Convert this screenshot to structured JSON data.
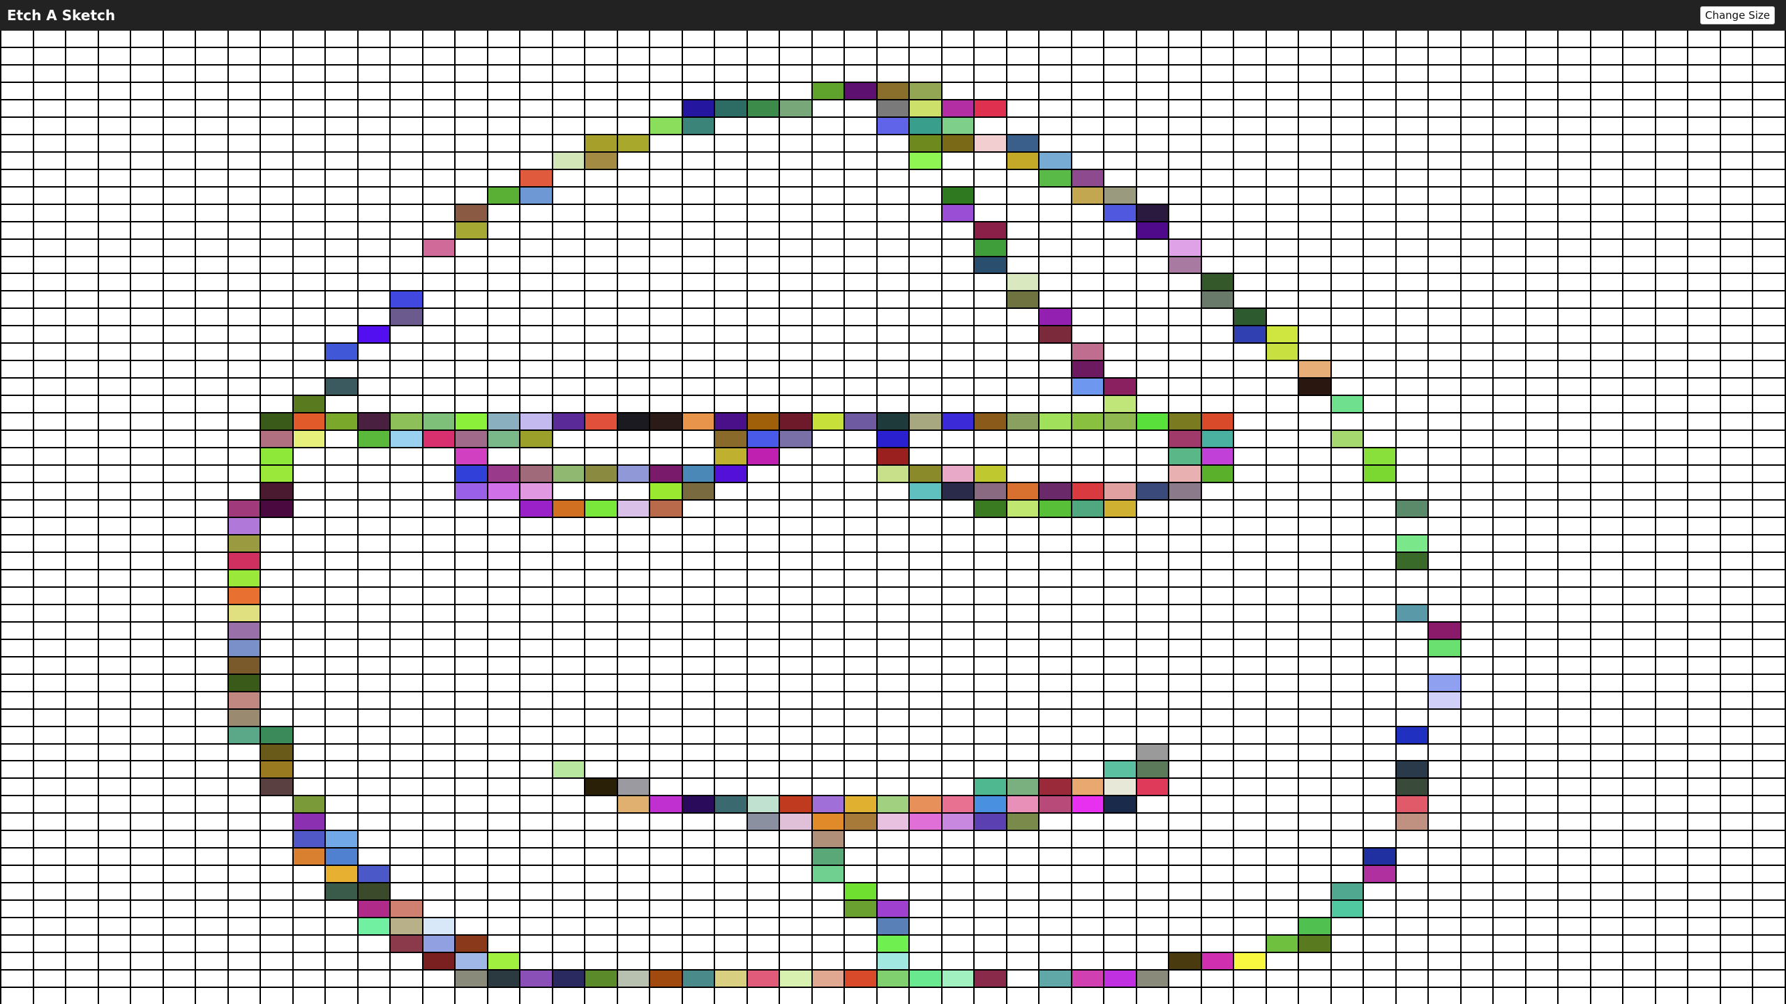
{
  "header": {
    "title": "Etch A Sketch",
    "change_size_label": "Change Size",
    "background": "#222222"
  },
  "grid": {
    "columns": 55,
    "rows": 56,
    "blank_color": "#ffffff",
    "painted": [
      [
        3,
        25,
        "#5fa32d"
      ],
      [
        3,
        26,
        "#5e1070"
      ],
      [
        3,
        27,
        "#8a6e2c"
      ],
      [
        3,
        28,
        "#93a653"
      ],
      [
        4,
        21,
        "#24169e"
      ],
      [
        4,
        22,
        "#2d6b65"
      ],
      [
        4,
        23,
        "#3d8b4a"
      ],
      [
        4,
        24,
        "#78a87a"
      ],
      [
        4,
        27,
        "#7a7a7a"
      ],
      [
        4,
        28,
        "#cde06a"
      ],
      [
        4,
        29,
        "#b32da3"
      ],
      [
        4,
        30,
        "#e0304f"
      ],
      [
        5,
        20,
        "#8ade5c"
      ],
      [
        5,
        21,
        "#3b847a"
      ],
      [
        5,
        27,
        "#5f64e8"
      ],
      [
        5,
        28,
        "#3a9e8c"
      ],
      [
        5,
        29,
        "#7dcf8a"
      ],
      [
        6,
        18,
        "#a6a02b"
      ],
      [
        6,
        19,
        "#a8a82c"
      ],
      [
        6,
        28,
        "#6e8a1f"
      ],
      [
        6,
        29,
        "#7a6a18"
      ],
      [
        6,
        30,
        "#f3ced1"
      ],
      [
        6,
        31,
        "#3a5f8a"
      ],
      [
        7,
        17,
        "#d3e6b7"
      ],
      [
        7,
        18,
        "#a38b43"
      ],
      [
        7,
        28,
        "#8ef553"
      ],
      [
        7,
        31,
        "#c4a929"
      ],
      [
        7,
        32,
        "#78abd3"
      ],
      [
        8,
        16,
        "#e05a3e"
      ],
      [
        8,
        32,
        "#5aba48"
      ],
      [
        8,
        33,
        "#8e4a8e"
      ],
      [
        9,
        15,
        "#5ab035"
      ],
      [
        9,
        16,
        "#6e98d3"
      ],
      [
        9,
        29,
        "#2f7a20"
      ],
      [
        9,
        33,
        "#c3a650"
      ],
      [
        9,
        34,
        "#9a9a7f"
      ],
      [
        10,
        14,
        "#8a5a42"
      ],
      [
        10,
        29,
        "#9a4ed6"
      ],
      [
        10,
        34,
        "#5058e0"
      ],
      [
        10,
        35,
        "#2a1a40"
      ],
      [
        11,
        14,
        "#a5a833"
      ],
      [
        11,
        30,
        "#8a2048"
      ],
      [
        11,
        35,
        "#4e0a8a"
      ],
      [
        12,
        13,
        "#d06a98"
      ],
      [
        12,
        30,
        "#3f9e3a"
      ],
      [
        12,
        36,
        "#e0a2e6"
      ],
      [
        13,
        30,
        "#2a4e6e"
      ],
      [
        13,
        36,
        "#a87aa2"
      ],
      [
        14,
        31,
        "#dae8c0"
      ],
      [
        14,
        37,
        "#35582a"
      ],
      [
        15,
        12,
        "#4048e0"
      ],
      [
        15,
        31,
        "#6f7340"
      ],
      [
        15,
        37,
        "#6a7a6a"
      ],
      [
        16,
        12,
        "#6a5a8e"
      ],
      [
        16,
        32,
        "#9320b0"
      ],
      [
        16,
        38,
        "#2e5a30"
      ],
      [
        17,
        11,
        "#5210f0"
      ],
      [
        17,
        32,
        "#7a2a3a"
      ],
      [
        17,
        38,
        "#3040b0"
      ],
      [
        17,
        39,
        "#d0e640"
      ],
      [
        18,
        10,
        "#4058d8"
      ],
      [
        18,
        33,
        "#c06e90"
      ],
      [
        18,
        39,
        "#c8e040"
      ],
      [
        19,
        33,
        "#6e1a60"
      ],
      [
        19,
        40,
        "#e8ae78"
      ],
      [
        20,
        10,
        "#3a5a60"
      ],
      [
        20,
        33,
        "#6e98f0"
      ],
      [
        20,
        34,
        "#8a2060"
      ],
      [
        20,
        40,
        "#2a1810"
      ],
      [
        21,
        9,
        "#5a7a20"
      ],
      [
        21,
        34,
        "#c0e67a"
      ],
      [
        21,
        41,
        "#6ee08e"
      ],
      [
        22,
        8,
        "#3a5a1a"
      ],
      [
        22,
        9,
        "#e05a2a"
      ],
      [
        22,
        10,
        "#7aa82a"
      ],
      [
        22,
        11,
        "#4a2040"
      ],
      [
        22,
        12,
        "#8ec05a"
      ],
      [
        22,
        13,
        "#7ec07a"
      ],
      [
        22,
        14,
        "#8af03a"
      ],
      [
        22,
        15,
        "#8ab0c0"
      ],
      [
        22,
        16,
        "#c4baf0"
      ],
      [
        22,
        17,
        "#5a2a98"
      ],
      [
        22,
        18,
        "#e0503a"
      ],
      [
        22,
        19,
        "#1a1a20"
      ],
      [
        22,
        20,
        "#2a1a18"
      ],
      [
        22,
        21,
        "#e8944a"
      ],
      [
        22,
        22,
        "#4a108a"
      ],
      [
        22,
        23,
        "#a0600a"
      ],
      [
        22,
        24,
        "#6e1a2a"
      ],
      [
        22,
        25,
        "#c8e03a"
      ],
      [
        22,
        26,
        "#6e5aa0"
      ],
      [
        22,
        27,
        "#1e3a3a"
      ],
      [
        22,
        28,
        "#a8a880"
      ],
      [
        22,
        29,
        "#3a2ad8"
      ],
      [
        22,
        30,
        "#8a5a1a"
      ],
      [
        22,
        31,
        "#8aa060"
      ],
      [
        22,
        32,
        "#a0e05a"
      ],
      [
        22,
        33,
        "#8ac040"
      ],
      [
        22,
        34,
        "#90b850"
      ],
      [
        22,
        35,
        "#5ae03a"
      ],
      [
        22,
        36,
        "#7a7a20"
      ],
      [
        22,
        37,
        "#d84a2a"
      ],
      [
        23,
        8,
        "#b07080"
      ],
      [
        23,
        9,
        "#e6f07a"
      ],
      [
        23,
        11,
        "#5ab83a"
      ],
      [
        23,
        12,
        "#9ad0f0"
      ],
      [
        23,
        13,
        "#d8306e"
      ],
      [
        23,
        14,
        "#a06a8a"
      ],
      [
        23,
        15,
        "#7ab88a"
      ],
      [
        23,
        16,
        "#9aa02a"
      ],
      [
        23,
        22,
        "#8a6a2a"
      ],
      [
        23,
        23,
        "#4a5ae8"
      ],
      [
        23,
        24,
        "#7a70a8"
      ],
      [
        23,
        27,
        "#2a20d0"
      ],
      [
        23,
        36,
        "#a03a6a"
      ],
      [
        23,
        37,
        "#4ab0a0"
      ],
      [
        23,
        41,
        "#a6d870"
      ],
      [
        24,
        8,
        "#8ee83a"
      ],
      [
        24,
        14,
        "#d040c0"
      ],
      [
        24,
        22,
        "#c0b030"
      ],
      [
        24,
        23,
        "#c020b0"
      ],
      [
        24,
        27,
        "#9a2020"
      ],
      [
        24,
        36,
        "#5ab888"
      ],
      [
        24,
        37,
        "#c040d8"
      ],
      [
        24,
        42,
        "#8ae03a"
      ],
      [
        25,
        8,
        "#9ae83a"
      ],
      [
        25,
        14,
        "#3040d8"
      ],
      [
        25,
        15,
        "#9a3a8a"
      ],
      [
        25,
        16,
        "#a06a7a"
      ],
      [
        25,
        17,
        "#90b870"
      ],
      [
        25,
        18,
        "#8a8a40"
      ],
      [
        25,
        19,
        "#9098d8"
      ],
      [
        25,
        20,
        "#7a1a6a"
      ],
      [
        25,
        21,
        "#4a88b8"
      ],
      [
        25,
        22,
        "#5210d8"
      ],
      [
        25,
        27,
        "#c8e08a"
      ],
      [
        25,
        28,
        "#8a8a2a"
      ],
      [
        25,
        29,
        "#e8a8c8"
      ],
      [
        25,
        30,
        "#c0c830"
      ],
      [
        25,
        36,
        "#e8b0b0"
      ],
      [
        25,
        37,
        "#5ab02a"
      ],
      [
        25,
        42,
        "#7ad830"
      ],
      [
        26,
        8,
        "#4a1a30"
      ],
      [
        26,
        14,
        "#9a60e8"
      ],
      [
        26,
        15,
        "#d070e8"
      ],
      [
        26,
        16,
        "#e098e0"
      ],
      [
        26,
        20,
        "#9ae830"
      ],
      [
        26,
        21,
        "#7a6a40"
      ],
      [
        26,
        28,
        "#60c0c0"
      ],
      [
        26,
        29,
        "#2a2a4a"
      ],
      [
        26,
        30,
        "#8a6a80"
      ],
      [
        26,
        31,
        "#d87030"
      ],
      [
        26,
        32,
        "#6a2a6a"
      ],
      [
        26,
        33,
        "#d83a40"
      ],
      [
        26,
        34,
        "#e0a0a0"
      ],
      [
        26,
        35,
        "#3a4a7a"
      ],
      [
        26,
        36,
        "#8a7a8a"
      ],
      [
        27,
        7,
        "#a03a7a"
      ],
      [
        27,
        8,
        "#4a0a40"
      ],
      [
        27,
        16,
        "#9a20c8"
      ],
      [
        27,
        17,
        "#d07020"
      ],
      [
        27,
        18,
        "#7ae83a"
      ],
      [
        27,
        19,
        "#d8c0e8"
      ],
      [
        27,
        20,
        "#b86a4a"
      ],
      [
        27,
        30,
        "#3a7a20"
      ],
      [
        27,
        31,
        "#c0e870"
      ],
      [
        27,
        32,
        "#58c038"
      ],
      [
        27,
        33,
        "#50a880"
      ],
      [
        27,
        34,
        "#d0b030"
      ],
      [
        27,
        43,
        "#5a8a6a"
      ],
      [
        28,
        7,
        "#b078d8"
      ],
      [
        29,
        7,
        "#9a9a40"
      ],
      [
        29,
        43,
        "#7ae88a"
      ],
      [
        30,
        7,
        "#d03060"
      ],
      [
        30,
        43,
        "#3a6a2a"
      ],
      [
        31,
        7,
        "#9ae83a"
      ],
      [
        32,
        7,
        "#e87030"
      ],
      [
        33,
        7,
        "#e0e080"
      ],
      [
        33,
        43,
        "#5a9aa8"
      ],
      [
        34,
        7,
        "#9a70a8"
      ],
      [
        34,
        44,
        "#8a1a6a"
      ],
      [
        35,
        7,
        "#7a90c8"
      ],
      [
        35,
        44,
        "#6ae070"
      ],
      [
        36,
        7,
        "#7a5a2a"
      ],
      [
        37,
        7,
        "#3a5a1a"
      ],
      [
        37,
        44,
        "#90a0f0"
      ],
      [
        38,
        7,
        "#c08880"
      ],
      [
        38,
        44,
        "#d0d0f8"
      ],
      [
        39,
        7,
        "#9a8a70"
      ],
      [
        40,
        7,
        "#5aa888"
      ],
      [
        40,
        8,
        "#3a8a5a"
      ],
      [
        40,
        43,
        "#2030c0"
      ],
      [
        41,
        8,
        "#6a5a1a"
      ],
      [
        41,
        35,
        "#9a9a9a"
      ],
      [
        42,
        8,
        "#9a7a20"
      ],
      [
        42,
        17,
        "#b8e8a0"
      ],
      [
        42,
        34,
        "#5ac0a0"
      ],
      [
        42,
        35,
        "#5a7a5a"
      ],
      [
        42,
        43,
        "#2a3a4a"
      ],
      [
        43,
        8,
        "#5a4040"
      ],
      [
        43,
        18,
        "#2a2008"
      ],
      [
        43,
        19,
        "#9a9aa0"
      ],
      [
        43,
        30,
        "#50b890"
      ],
      [
        43,
        31,
        "#7ab080"
      ],
      [
        43,
        32,
        "#9a2a3a"
      ],
      [
        43,
        33,
        "#e8a870"
      ],
      [
        43,
        34,
        "#e8e8d8"
      ],
      [
        43,
        35,
        "#e03a5a"
      ],
      [
        43,
        43,
        "#3a4a3a"
      ],
      [
        44,
        9,
        "#7a9a3a"
      ],
      [
        44,
        19,
        "#e0b070"
      ],
      [
        44,
        20,
        "#c030d0"
      ],
      [
        44,
        21,
        "#2a0a5a"
      ],
      [
        44,
        22,
        "#3a6a70"
      ],
      [
        44,
        23,
        "#c0e0d0"
      ],
      [
        44,
        24,
        "#c03a20"
      ],
      [
        44,
        25,
        "#a070d8"
      ],
      [
        44,
        26,
        "#e0b030"
      ],
      [
        44,
        27,
        "#a0d080"
      ],
      [
        44,
        28,
        "#e8905a"
      ],
      [
        44,
        29,
        "#e87090"
      ],
      [
        44,
        30,
        "#4a90e0"
      ],
      [
        44,
        31,
        "#e890b8"
      ],
      [
        44,
        32,
        "#b84a7a"
      ],
      [
        44,
        33,
        "#e830f0"
      ],
      [
        44,
        34,
        "#1a2a4a"
      ],
      [
        44,
        43,
        "#e05a6a"
      ],
      [
        45,
        9,
        "#8a30b0"
      ],
      [
        45,
        23,
        "#8a90a0"
      ],
      [
        45,
        24,
        "#e0c0d8"
      ],
      [
        45,
        25,
        "#e08a2a"
      ],
      [
        45,
        26,
        "#a87a3a"
      ],
      [
        45,
        27,
        "#e8c0e0"
      ],
      [
        45,
        28,
        "#e070d8"
      ],
      [
        45,
        29,
        "#c888e0"
      ],
      [
        45,
        30,
        "#5a40b0"
      ],
      [
        45,
        31,
        "#7a8a4a"
      ],
      [
        45,
        43,
        "#c09080"
      ],
      [
        46,
        9,
        "#5058c8"
      ],
      [
        46,
        10,
        "#70a8e8"
      ],
      [
        46,
        25,
        "#b09078"
      ],
      [
        47,
        9,
        "#d88030"
      ],
      [
        47,
        10,
        "#5080d0"
      ],
      [
        47,
        25,
        "#5aa878"
      ],
      [
        47,
        42,
        "#2030a0"
      ],
      [
        48,
        10,
        "#e8b030"
      ],
      [
        48,
        11,
        "#4a58c8"
      ],
      [
        48,
        25,
        "#70d090"
      ],
      [
        48,
        42,
        "#b030a0"
      ],
      [
        49,
        10,
        "#3a5a4a"
      ],
      [
        49,
        11,
        "#3a4a2a"
      ],
      [
        49,
        26,
        "#70e030"
      ],
      [
        49,
        41,
        "#50a890"
      ],
      [
        50,
        11,
        "#b02a8a"
      ],
      [
        50,
        12,
        "#d08070"
      ],
      [
        50,
        26,
        "#6aa030"
      ],
      [
        50,
        27,
        "#a040d0"
      ],
      [
        50,
        41,
        "#50c8a0"
      ],
      [
        51,
        11,
        "#70f0a0"
      ],
      [
        51,
        12,
        "#b8b088"
      ],
      [
        51,
        13,
        "#d8e8f8"
      ],
      [
        51,
        27,
        "#5a80b8"
      ],
      [
        51,
        40,
        "#50c050"
      ],
      [
        52,
        12,
        "#8a3a4a"
      ],
      [
        52,
        13,
        "#90a0e0"
      ],
      [
        52,
        14,
        "#8a3a1a"
      ],
      [
        52,
        27,
        "#70f050"
      ],
      [
        52,
        39,
        "#70c040"
      ],
      [
        52,
        40,
        "#5a7a20"
      ],
      [
        53,
        13,
        "#7a2020"
      ],
      [
        53,
        14,
        "#a0b8e8"
      ],
      [
        53,
        15,
        "#a0f040"
      ],
      [
        53,
        27,
        "#a0e8e0"
      ],
      [
        53,
        36,
        "#4a3a10"
      ],
      [
        53,
        37,
        "#d030b0"
      ],
      [
        53,
        38,
        "#f8f840"
      ],
      [
        54,
        14,
        "#8a8a7a"
      ],
      [
        54,
        15,
        "#2a3a40"
      ],
      [
        54,
        16,
        "#8a50b8"
      ],
      [
        54,
        17,
        "#2a2a60"
      ],
      [
        54,
        18,
        "#5a8a2a"
      ],
      [
        54,
        19,
        "#b8c0b0"
      ],
      [
        54,
        20,
        "#a04a10"
      ],
      [
        54,
        21,
        "#4a8a8a"
      ],
      [
        54,
        22,
        "#d8d080"
      ],
      [
        54,
        23,
        "#e05a7a"
      ],
      [
        54,
        24,
        "#d8f0b0"
      ],
      [
        54,
        25,
        "#e0a890"
      ],
      [
        54,
        26,
        "#d84a2a"
      ],
      [
        54,
        27,
        "#80d070"
      ],
      [
        54,
        28,
        "#6ae890"
      ],
      [
        54,
        29,
        "#a0f0c0"
      ],
      [
        54,
        30,
        "#8a2a4a"
      ],
      [
        54,
        32,
        "#60a8a8"
      ],
      [
        54,
        33,
        "#d040b0"
      ],
      [
        54,
        34,
        "#c030e0"
      ],
      [
        54,
        35,
        "#8a8a7a"
      ]
    ]
  }
}
